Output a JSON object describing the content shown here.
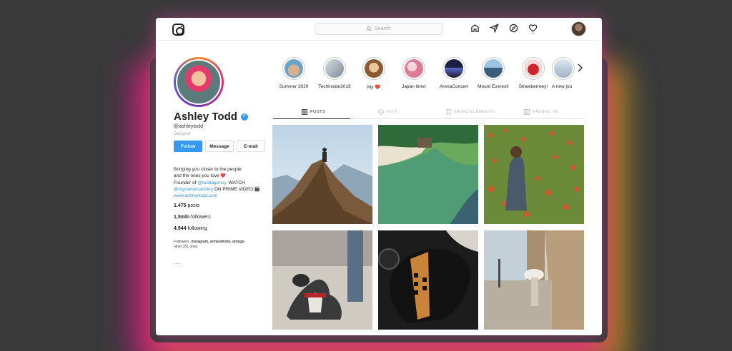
{
  "search": {
    "placeholder": "Search"
  },
  "profile": {
    "name": "Ashley Todd",
    "handle": "@ashleytodd",
    "role": "Designer",
    "buttons": {
      "follow": "Follow",
      "message": "Message",
      "email": "E-mail"
    },
    "bio": {
      "line1": "Bringing you closer to the people",
      "line2_prefix": "and the ones you love",
      "line2_emoji": "❤️",
      "line3_prefix": "Founder of ",
      "line3_link": "@toddagency",
      "line3_suffix": ". WATCH",
      "line4_link": "@mynameisashley",
      "line4_suffix": " ON PRIME VIDEO 🎬",
      "website": "www.ashleytodd.com"
    },
    "stats": {
      "posts_value": "1.475",
      "posts_label": "posts",
      "followers_value": "1,5mln",
      "followers_label": "followers",
      "following_value": "4.944",
      "following_label": "following"
    },
    "followers_note": {
      "prefix": "Followers: ",
      "names": "instagram, armanihotel, omega",
      "others": "other 351 ones"
    },
    "more": "..."
  },
  "stories": [
    {
      "label": "Summer 2020",
      "color": "#c9a07a"
    },
    {
      "label": "Techinside2019",
      "color": "#9aa6b0"
    },
    {
      "label": "My ❤️",
      "color": "#b8844e"
    },
    {
      "label": "Japan time!",
      "color": "#e8a6b6"
    },
    {
      "label": "ArenaConcert",
      "color": "#2a2f5c"
    },
    {
      "label": "Mount Everest!",
      "color": "#3e6a8c"
    },
    {
      "label": "Strawberreey!",
      "color": "#c8323a"
    },
    {
      "label": "A new jou",
      "color": "#b9c7d6"
    }
  ],
  "tabs": [
    {
      "label": "POSTS",
      "active": true
    },
    {
      "label": "IGTV",
      "active": false
    },
    {
      "label": "SAVED ELEMENTS",
      "active": false
    },
    {
      "label": "TAGGED IN",
      "active": false
    }
  ],
  "posts": [
    {
      "name": "post-hiker-mountain"
    },
    {
      "name": "post-aerial-coast"
    },
    {
      "name": "post-poppy-field"
    },
    {
      "name": "post-dog-leash"
    },
    {
      "name": "post-motorcycle-tank"
    },
    {
      "name": "post-street-umbrella"
    }
  ]
}
